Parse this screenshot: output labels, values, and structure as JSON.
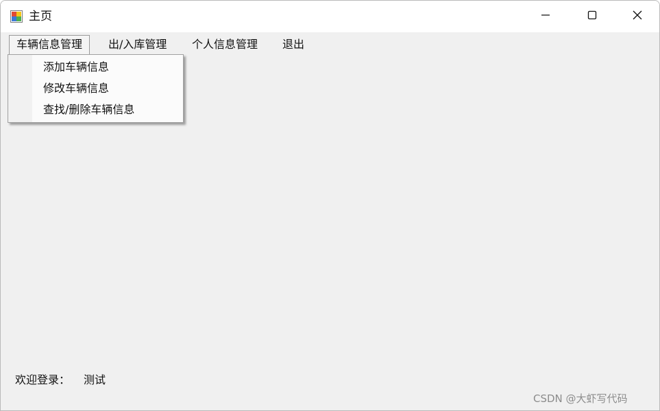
{
  "window": {
    "title": "主页",
    "app_icon": "winforms-app-icon",
    "controls": {
      "minimize_icon": "minimize-icon",
      "maximize_icon": "maximize-icon",
      "close_icon": "close-icon"
    }
  },
  "menubar": {
    "items": [
      {
        "label": "车辆信息管理",
        "active": true
      },
      {
        "label": "出/入库管理",
        "active": false
      },
      {
        "label": "个人信息管理",
        "active": false
      },
      {
        "label": "退出",
        "active": false
      }
    ]
  },
  "dropdown": {
    "items": [
      {
        "label": "添加车辆信息"
      },
      {
        "label": "修改车辆信息"
      },
      {
        "label": "查找/删除车辆信息"
      }
    ]
  },
  "status": {
    "welcome_label": "欢迎登录：",
    "username": "测试"
  },
  "watermark": "CSDN @大虾写代码",
  "colors": {
    "client_background": "#f0f0f0",
    "titlebar_background": "#ffffff",
    "dropdown_background": "#fbfbfb"
  }
}
